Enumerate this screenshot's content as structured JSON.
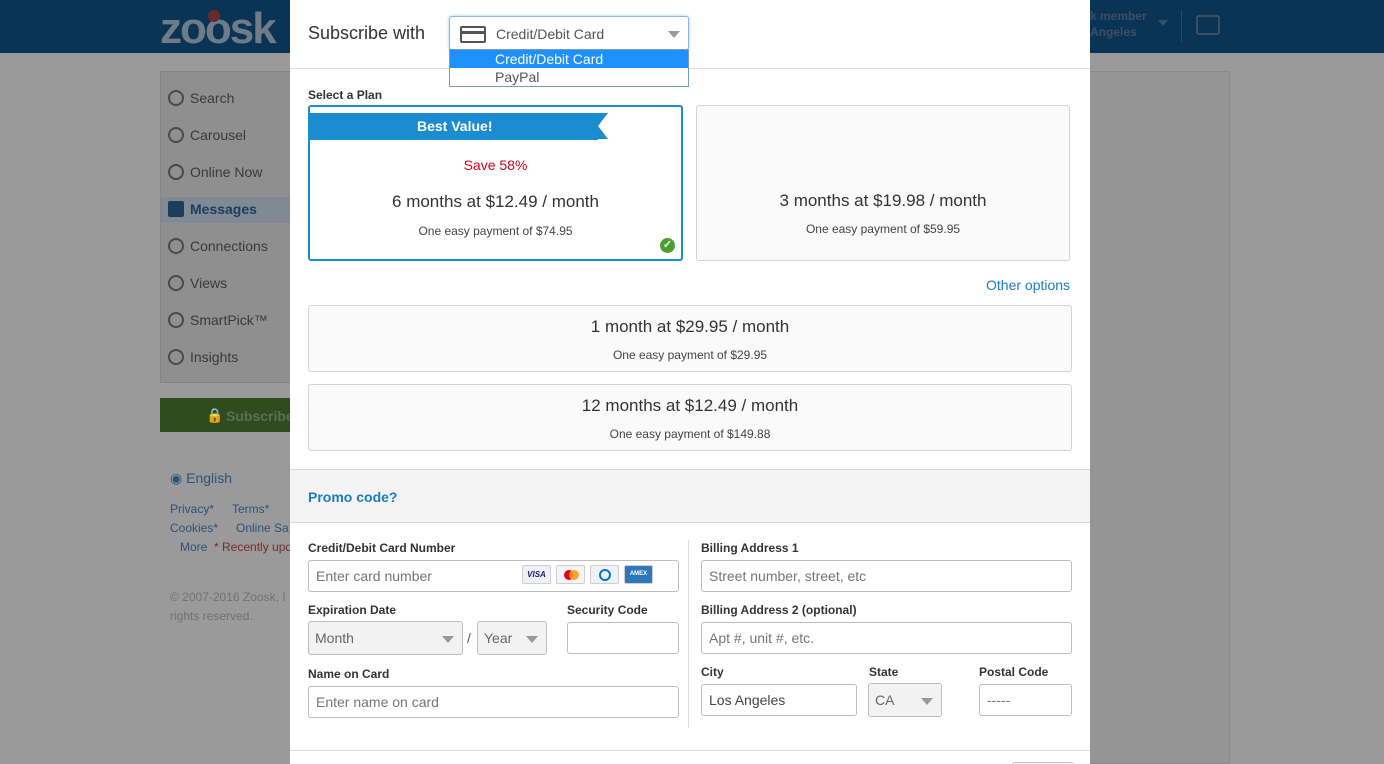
{
  "background": {
    "logo": "zoosk",
    "top_user_line1": "k member",
    "top_user_line2": "Angeles",
    "sidebar": {
      "items": [
        {
          "label": "Search",
          "icon": "search-icon"
        },
        {
          "label": "Carousel",
          "icon": "carousel-icon"
        },
        {
          "label": "Online Now",
          "icon": "online-now-icon"
        },
        {
          "label": "Messages",
          "icon": "messages-icon"
        },
        {
          "label": "Connections",
          "icon": "connections-icon"
        },
        {
          "label": "Views",
          "icon": "views-icon"
        },
        {
          "label": "SmartPick™",
          "icon": "smartpick-icon"
        },
        {
          "label": "Insights",
          "icon": "insights-icon"
        }
      ],
      "subscribe_label": "Subscribe"
    },
    "language": "English",
    "footer_links": {
      "privacy": "Privacy*",
      "terms": "Terms*",
      "cookies": "Cookies*",
      "online_safety": "Online Sa",
      "more": "More",
      "recently_updated": "* Recently upd"
    },
    "copyright_line1": "© 2007-2016 Zoosk, I",
    "copyright_line2": "rights reserved."
  },
  "modal": {
    "subscribe_with_label": "Subscribe with",
    "payment_method": {
      "selected": "Credit/Debit Card",
      "options": [
        "Credit/Debit Card",
        "PayPal"
      ]
    },
    "select_plan_label": "Select a Plan",
    "plans": [
      {
        "ribbon": "Best Value!",
        "save": "Save 58%",
        "main": "6 months at $12.49 / month",
        "sub": "One easy payment of $74.95",
        "selected": true
      },
      {
        "main": "3 months at $19.98 / month",
        "sub": "One easy payment of $59.95"
      },
      {
        "main": "1 month at $29.95 / month",
        "sub": "One easy payment of $29.95"
      },
      {
        "main": "12 months at $12.49 / month",
        "sub": "One easy payment of $149.88"
      }
    ],
    "other_options": "Other options",
    "promo_code": "Promo code?",
    "form": {
      "card_number_label": "Credit/Debit Card Number",
      "card_number_placeholder": "Enter card number",
      "card_brands": [
        "VISA",
        "Mastercard",
        "Diners Club",
        "American Express"
      ],
      "expiration_label": "Expiration Date",
      "month_value": "Month",
      "slash": "/",
      "year_value": "Year",
      "security_code_label": "Security Code",
      "name_label": "Name on Card",
      "name_placeholder": "Enter name on card",
      "billing1_label": "Billing Address 1",
      "billing1_placeholder": "Street number, street, etc",
      "billing2_label": "Billing Address 2 (optional)",
      "billing2_placeholder": "Apt #, unit #, etc.",
      "city_label": "City",
      "city_value": "Los Angeles",
      "state_label": "State",
      "state_value": "CA",
      "postal_label": "Postal Code",
      "postal_placeholder": "-----"
    }
  },
  "colors": {
    "accent": "#1a8ccf",
    "link": "#1a7cc4",
    "save_red": "#d0021b",
    "check_green": "#4aa02c",
    "dropdown_highlight": "#1e90ff"
  }
}
